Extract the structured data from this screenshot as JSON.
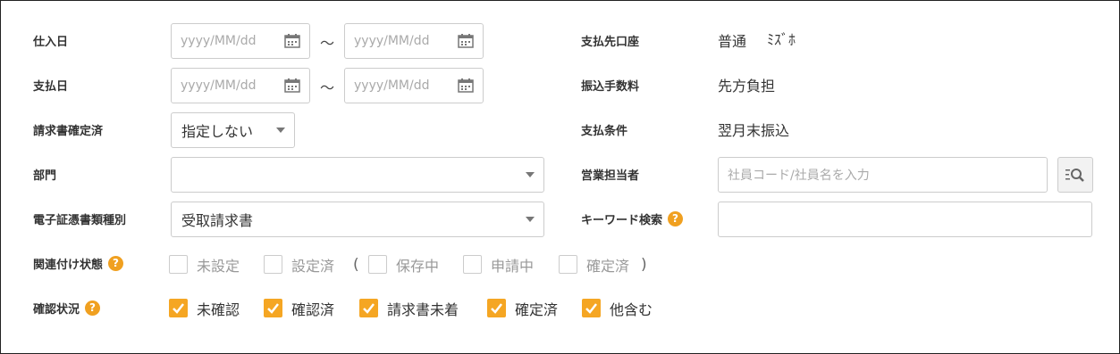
{
  "labels": {
    "shiire_bi": "仕入日",
    "shiharai_bi": "支払日",
    "seikyusho_kakutei": "請求書確定済",
    "bumon": "部門",
    "denshi_shurui": "電子証憑書類種別",
    "kanren_joutai": "関連付け状態",
    "kakunin_joukyou": "確認状況",
    "shiharai_koza": "支払先口座",
    "furikomi_tesuryo": "振込手数料",
    "shiharai_jouken": "支払条件",
    "eigyo_tantou": "営業担当者",
    "keyword": "キーワード検索"
  },
  "help_glyph": "?",
  "tilde": "～",
  "date_placeholder": "yyyy/MM/dd",
  "selects": {
    "seikyusho_kakutei": "指定しない",
    "bumon": "",
    "denshi_shurui": "受取請求書"
  },
  "values": {
    "shiharai_koza_type": "普通",
    "shiharai_koza_bank": "ﾐｽﾞﾎ",
    "furikomi_tesuryo": "先方負担",
    "shiharai_jouken": "翌月末振込"
  },
  "eigyo_placeholder": "社員コード/社員名を入力",
  "keyword_value": "",
  "kanren_options": [
    {
      "label": "未設定",
      "checked": false
    },
    {
      "label": "設定済",
      "checked": false
    },
    {
      "label": "保存中",
      "checked": false
    },
    {
      "label": "申請中",
      "checked": false
    },
    {
      "label": "確定済",
      "checked": false
    }
  ],
  "paren_open": "(",
  "paren_close": ")",
  "kakunin_options": [
    {
      "label": "未確認",
      "checked": true
    },
    {
      "label": "確認済",
      "checked": true
    },
    {
      "label": "請求書未着",
      "checked": true
    },
    {
      "label": "確定済",
      "checked": true
    },
    {
      "label": "他含む",
      "checked": true
    }
  ],
  "colors": {
    "accent": "#f5a623",
    "help": "#f0a020",
    "border": "#cccccc"
  }
}
